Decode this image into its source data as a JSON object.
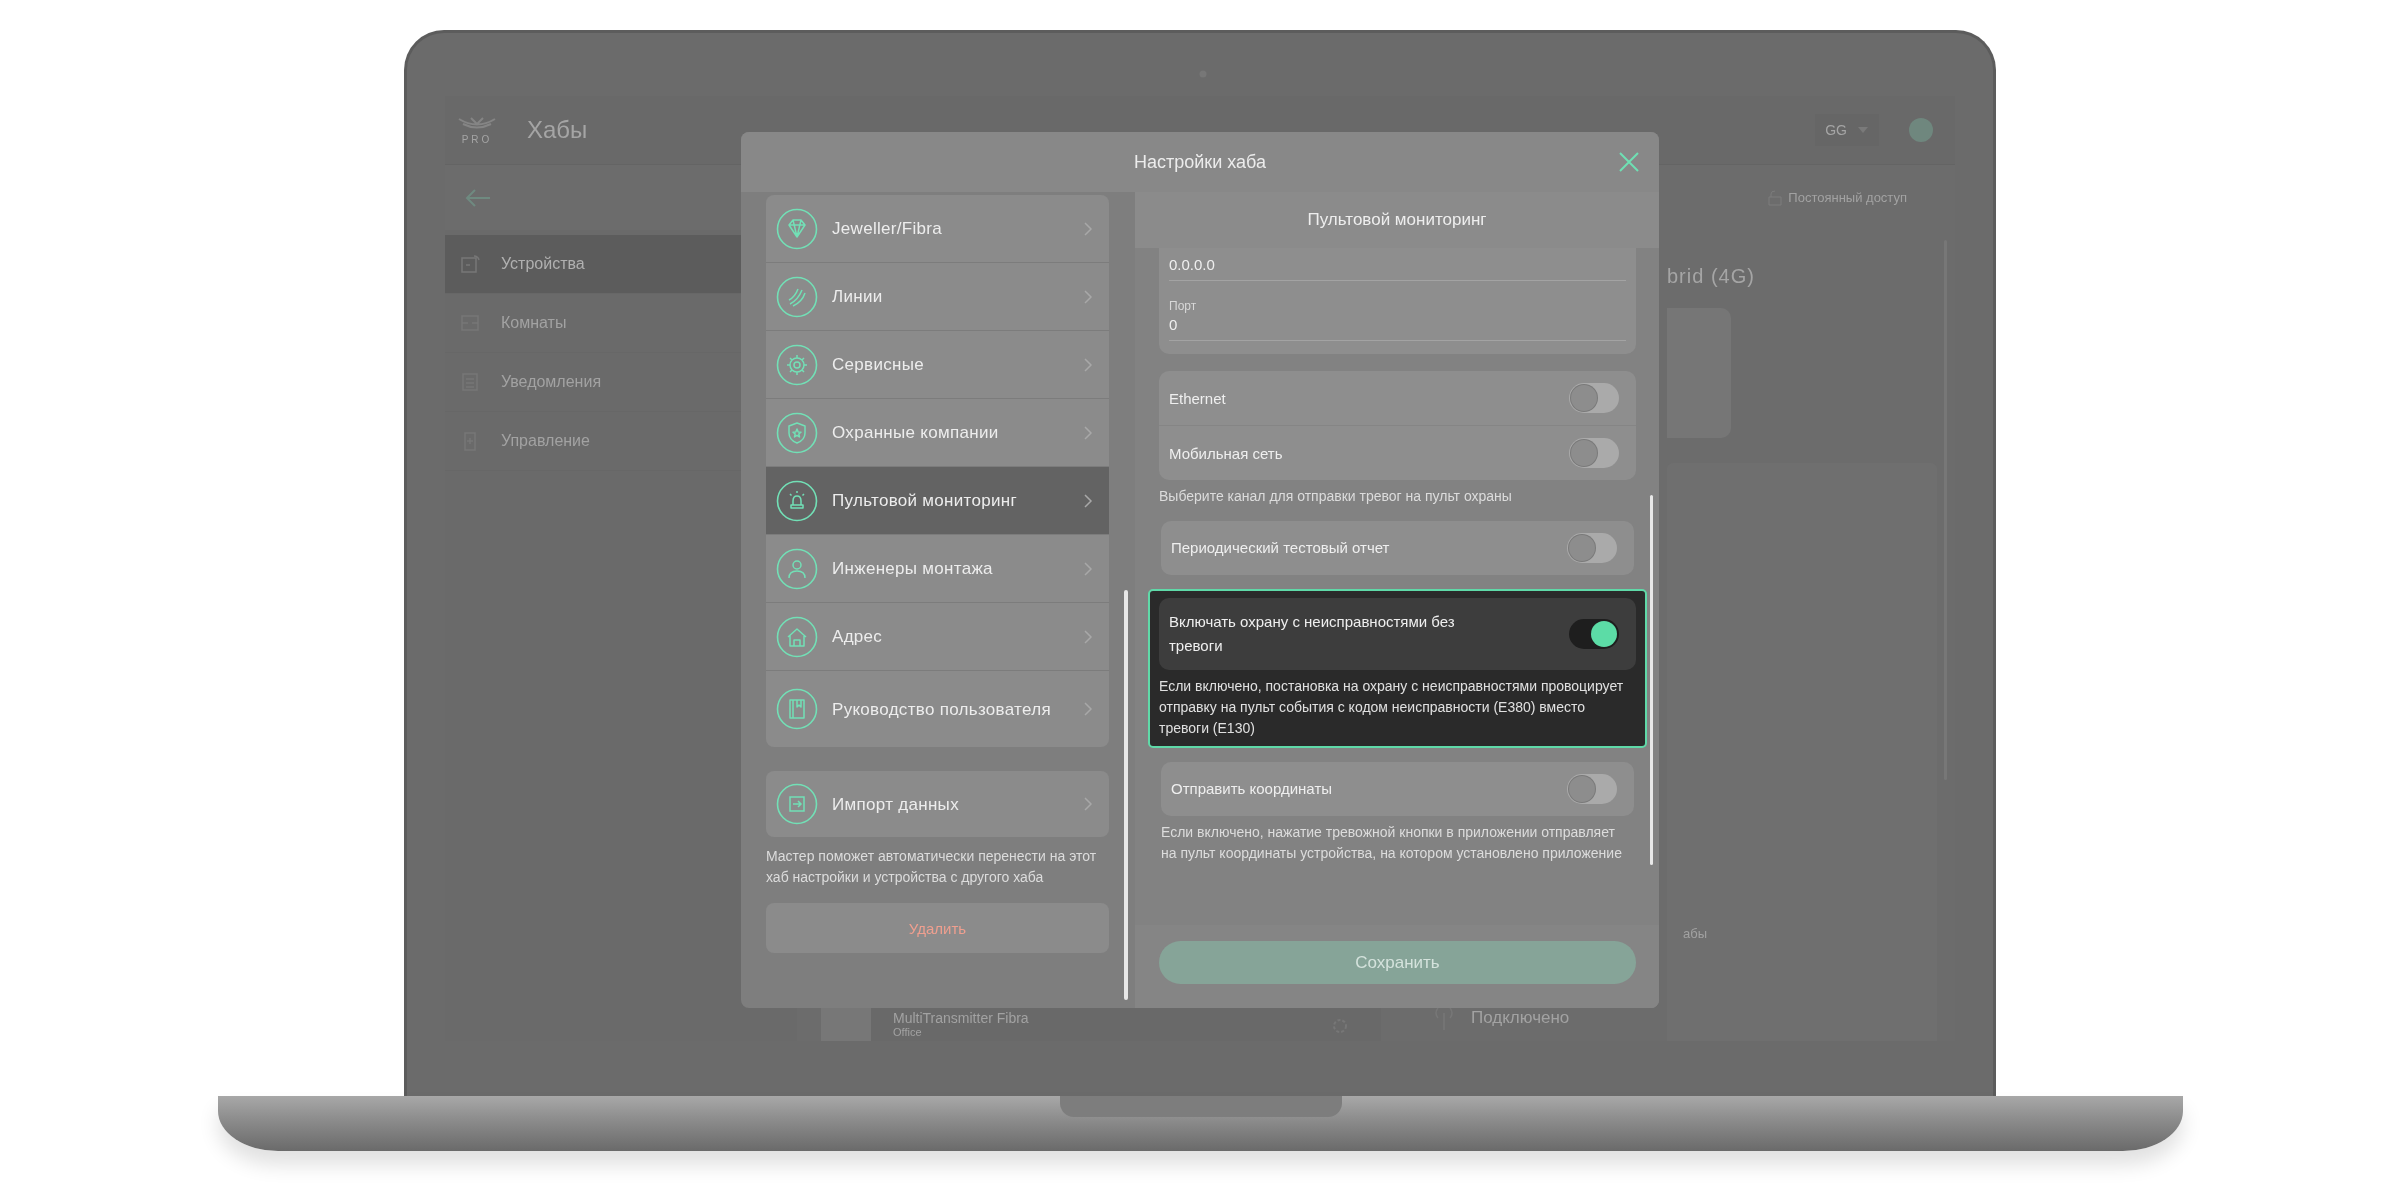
{
  "background_app": {
    "logo": "PRO",
    "title": "Хабы",
    "user_menu": "GG",
    "access_label": "Постоянный доступ",
    "sidebar": [
      {
        "label": "Устройства",
        "kind": "device",
        "selected": true
      },
      {
        "label": "Комнаты",
        "kind": "room",
        "selected": false
      },
      {
        "label": "Уведомления",
        "kind": "list",
        "selected": false
      },
      {
        "label": "Управление",
        "kind": "remote",
        "selected": false
      }
    ],
    "hub_title": "brid (4G)",
    "device_row": {
      "name": "MultiTransmitter  Fibra",
      "room": "Office"
    },
    "status": "Подключено",
    "partial_text": "абы"
  },
  "modal": {
    "title": "Настройки хаба",
    "menu": [
      {
        "label": "Jeweller/Fibra",
        "kind": "diamond",
        "selected": false
      },
      {
        "label": "Линии",
        "kind": "lines",
        "selected": false
      },
      {
        "label": "Сервисные",
        "kind": "gear",
        "selected": false
      },
      {
        "label": "Охранные компании",
        "kind": "shield",
        "selected": false
      },
      {
        "label": "Пультовой мониторинг",
        "kind": "siren",
        "selected": true
      },
      {
        "label": "Инженеры монтажа",
        "kind": "person",
        "selected": false
      },
      {
        "label": "Адрес",
        "kind": "house",
        "selected": false
      },
      {
        "label": "Руководство пользователя",
        "kind": "book",
        "selected": false
      }
    ],
    "import": {
      "label": "Импорт данных",
      "description": "Мастер поможет автоматически перенести на этот хаб настройки и устройства с другого хаба"
    },
    "delete_button": "Удалить",
    "panel": {
      "title": "Пультовой мониторинг",
      "address_value": "0.0.0.0",
      "port": {
        "label": "Порт",
        "value": "0"
      },
      "channels": [
        {
          "label": "Ethernet",
          "on": false
        },
        {
          "label": "Мобильная сеть",
          "on": false
        }
      ],
      "channels_hint": "Выберите канал для отправки тревог на пульт охраны",
      "settings": [
        {
          "label": "Периодический тестовый отчет",
          "on": false,
          "highlighted": false
        },
        {
          "label": "Включать охрану с неисправностями без тревоги",
          "on": true,
          "highlighted": true,
          "hint": "Если включено, постановка на охрану с неисправностями провоцирует отправку на пульт события с кодом неисправности (E380) вместо тревоги (E130)"
        },
        {
          "label": "Отправить координаты",
          "on": false,
          "highlighted": false,
          "hint": "Если включено, нажатие тревожной кнопки в приложении отправляет на пульт координаты устройства, на котором установлено приложение"
        }
      ],
      "save_button": {
        "label": "Сохранить",
        "disabled": true
      }
    }
  }
}
